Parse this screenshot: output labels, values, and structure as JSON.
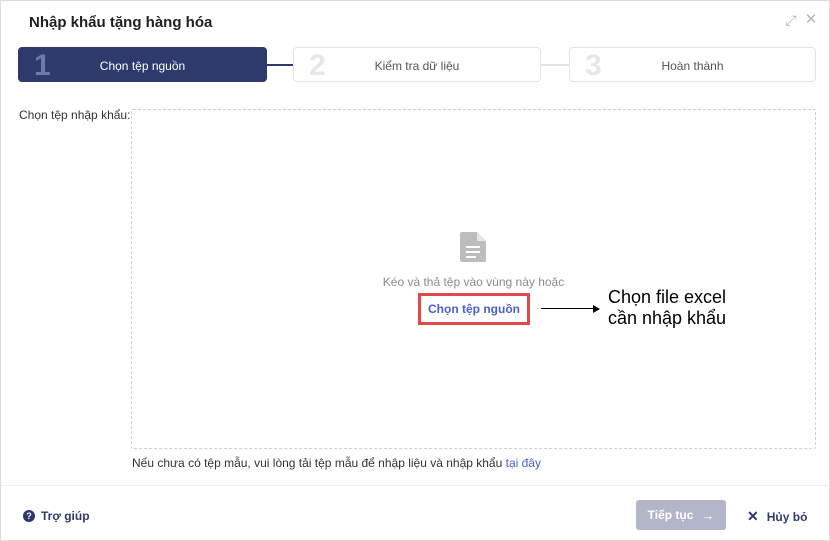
{
  "dialog": {
    "title": "Nhập khẩu tặng hàng hóa",
    "expand_icon": "expand-icon",
    "close_icon": "close-icon"
  },
  "stepper": {
    "steps": [
      {
        "number": "1",
        "label": "Chọn tệp nguồn",
        "active": true
      },
      {
        "number": "2",
        "label": "Kiểm tra dữ liệu",
        "active": false
      },
      {
        "number": "3",
        "label": "Hoàn thành",
        "active": false
      }
    ]
  },
  "upload": {
    "label": "Chọn tệp nhập khẩu:",
    "hint": "Kéo và thả tệp vào vùng này hoặc",
    "choose_link": "Chọn tệp nguồn",
    "file_icon": "file-document-icon"
  },
  "callout": {
    "line1": "Chọn file excel",
    "line2": "cần nhập khẩu"
  },
  "template_note": {
    "text": "Nếu chưa có tệp mẫu, vui lòng tải tệp mẫu để nhập liệu và nhập khẩu ",
    "link": "tại đây"
  },
  "footer": {
    "help_label": "Trợ giúp",
    "next_label": "Tiếp tục",
    "cancel_label": "Hủy bỏ"
  },
  "colors": {
    "accent": "#2d3a6b",
    "link": "#4a5fcf",
    "highlight": "#e5474b",
    "disabled_button": "#b3b6c8"
  }
}
